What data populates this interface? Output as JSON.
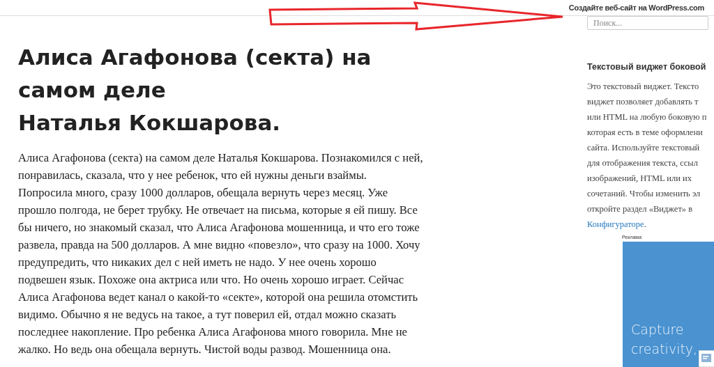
{
  "top_bar": {
    "link": "Создайте веб-сайт на WordPress.com"
  },
  "search": {
    "placeholder": "Поиск..."
  },
  "article": {
    "title": "Алиса Агафонова (секта) на самом деле\nНаталья Кокшарова.",
    "body": "Алиса Агафонова (секта) на самом деле Наталья Кокшарова. Познакомился с ней, понравилась, сказала, что у нее ребенок, что ей нужны деньги взаймы. Попросила много, сразу 1000 долларов, обещала вернуть через месяц. Уже прошло полгода, не берет трубку. Не отвечает на письма, которые я ей пишу. Все бы ничего, но знакомый сказал, что Алиса Агафонова мошенница, и что его тоже развела, правда на 500 долларов. А мне видно «повезло», что сразу на 1000. Хочу предупредить, что никаких дел с ней иметь не надо. У нее очень хорошо подвешен язык. Похоже она актриса или что. Но очень хорошо играет. Сейчас Алиса Агафонова ведет канал о какой-то «секте», которой она решила отомстить видимо. Обычно я не ведусь на такое, а тут поверил ей, отдал можно сказать последнее накопление. Про ребенка Алиса Агафонова много говорила. Мне не жалко. Но ведь она обещала вернуть. Чистой воды развод. Мошенница она."
  },
  "widget": {
    "title": "Текстовый виджет боковой",
    "lines": [
      "Это текстовый виджет. Тексто",
      "виджет позволяет добавлять т",
      "или HTML на любую боковую п",
      "которая есть в теме оформлени",
      "сайта. Используйте текстовый",
      "для отображения текста, ссыл",
      "изображений, HTML или их",
      "сочетаний. Чтобы изменить эл",
      "откройте раздел «Виджет» в"
    ],
    "link": "Конфигураторе",
    "link_tail": "."
  },
  "ad": {
    "label": "Реклама",
    "text": "Capture creativity,"
  }
}
